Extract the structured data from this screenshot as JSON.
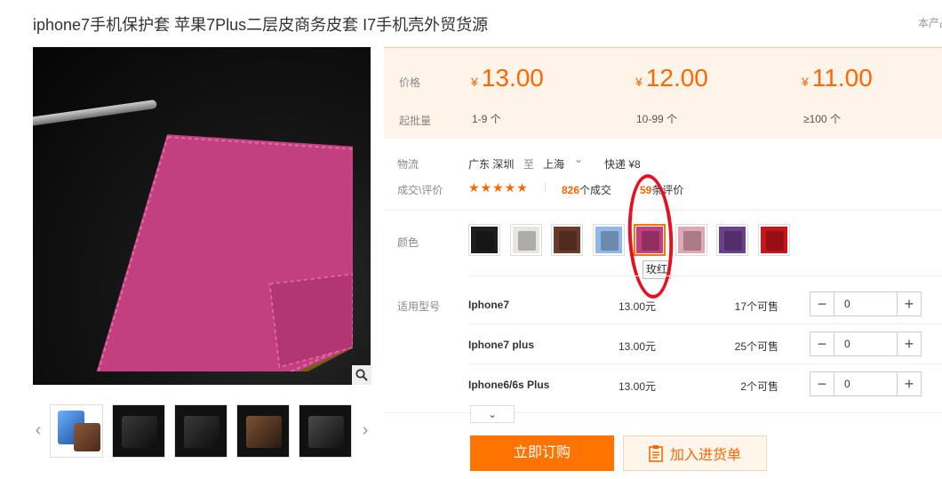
{
  "product": {
    "title": "iphone7手机保护套 苹果7Plus二层皮商务皮套 I7手机壳外贸货源",
    "source_tag": "本产品"
  },
  "price_panel": {
    "price_label": "价格",
    "moq_label": "起批量",
    "tiers": [
      {
        "symbol": "¥",
        "price": "13.00",
        "qty": "1-9 个"
      },
      {
        "symbol": "¥",
        "price": "12.00",
        "qty": "10-99 个"
      },
      {
        "symbol": "¥",
        "price": "11.00",
        "qty": "≥100 个"
      }
    ],
    "accent_color": "#ff6600"
  },
  "logistics": {
    "label": "物流",
    "from": "广东 深圳",
    "to_word": "至",
    "to": "上海",
    "method": "快递 ¥8"
  },
  "deals": {
    "label": "成交\\评价",
    "stars": "★★★★★",
    "deal_count": "826",
    "deal_suffix": "个成交",
    "review_count": "59",
    "review_suffix": "条评价"
  },
  "color": {
    "label": "颜色",
    "swatches": [
      {
        "name": "black",
        "color": "#1e1e1e"
      },
      {
        "name": "white",
        "color": "#e8e6e2"
      },
      {
        "name": "brown",
        "color": "#6b3a2a"
      },
      {
        "name": "blue",
        "color": "#8fb8e8"
      },
      {
        "name": "rose-red",
        "color": "#c2407f"
      },
      {
        "name": "pink",
        "color": "#e2a6b6"
      },
      {
        "name": "purple",
        "color": "#6d3f8f"
      },
      {
        "name": "red",
        "color": "#c8151b"
      }
    ],
    "selected_index": 4,
    "tooltip": "玫红"
  },
  "models": {
    "label": "适用型号",
    "rows": [
      {
        "name": "Iphone7",
        "price": "13.00元",
        "stock": "17个可售",
        "qty": "0"
      },
      {
        "name": "Iphone7 plus",
        "price": "13.00元",
        "stock": "25个可售",
        "qty": "0"
      },
      {
        "name": "Iphone6/6s Plus",
        "price": "13.00元",
        "stock": "2个可售",
        "qty": "0"
      }
    ]
  },
  "actions": {
    "buy_now": "立即订购",
    "add_to_cart": "加入进货单"
  },
  "icons": {
    "zoom": "magnifier-icon",
    "prev": "chevron-left-icon",
    "next": "chevron-right-icon",
    "dropdown": "chevron-down-icon",
    "clipboard": "clipboard-icon",
    "minus": "−",
    "plus": "+",
    "expand": "⌄"
  },
  "annotation_color": "#e8101e"
}
